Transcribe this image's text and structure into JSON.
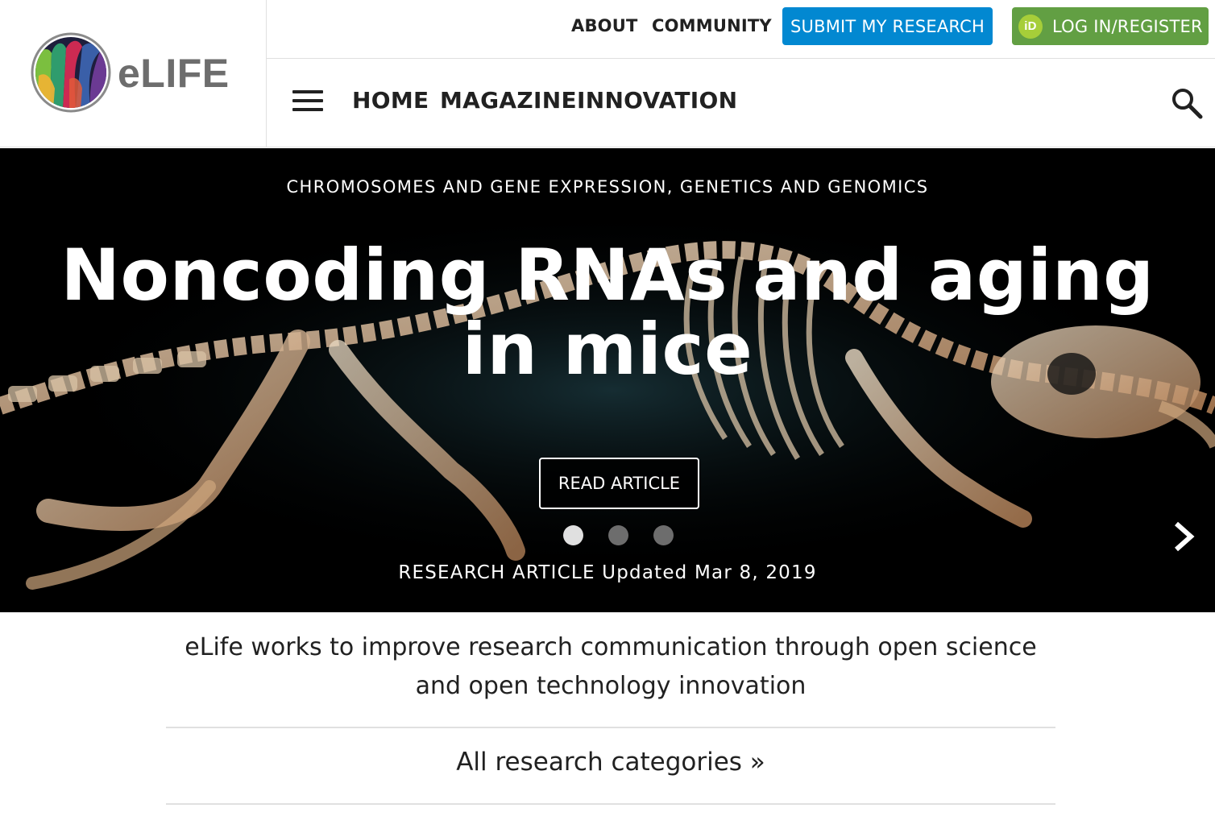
{
  "brand": {
    "name": "eLIFE"
  },
  "top_nav": {
    "about": "ABOUT",
    "community": "COMMUNITY",
    "submit": "SUBMIT MY RESEARCH",
    "login": "LOG IN/REGISTER",
    "login_icon_text": "iD",
    "submit_color": "#0288d1",
    "login_color": "#629f43"
  },
  "main_nav": {
    "items": [
      {
        "label": "HOME"
      },
      {
        "label": "MAGAZINE"
      },
      {
        "label": "INNOVATION"
      }
    ]
  },
  "hero": {
    "subjects": "CHROMOSOMES AND GENE EXPRESSION, GENETICS AND GENOMICS",
    "title": "Noncoding RNAs and aging in mice",
    "cta": "READ ARTICLE",
    "meta": "RESEARCH ARTICLE Updated Mar 8, 2019",
    "slides_total": 3,
    "active_slide": 1
  },
  "mission": "eLife works to improve research communication through open science and open technology innovation",
  "categories_link": "All research categories »"
}
